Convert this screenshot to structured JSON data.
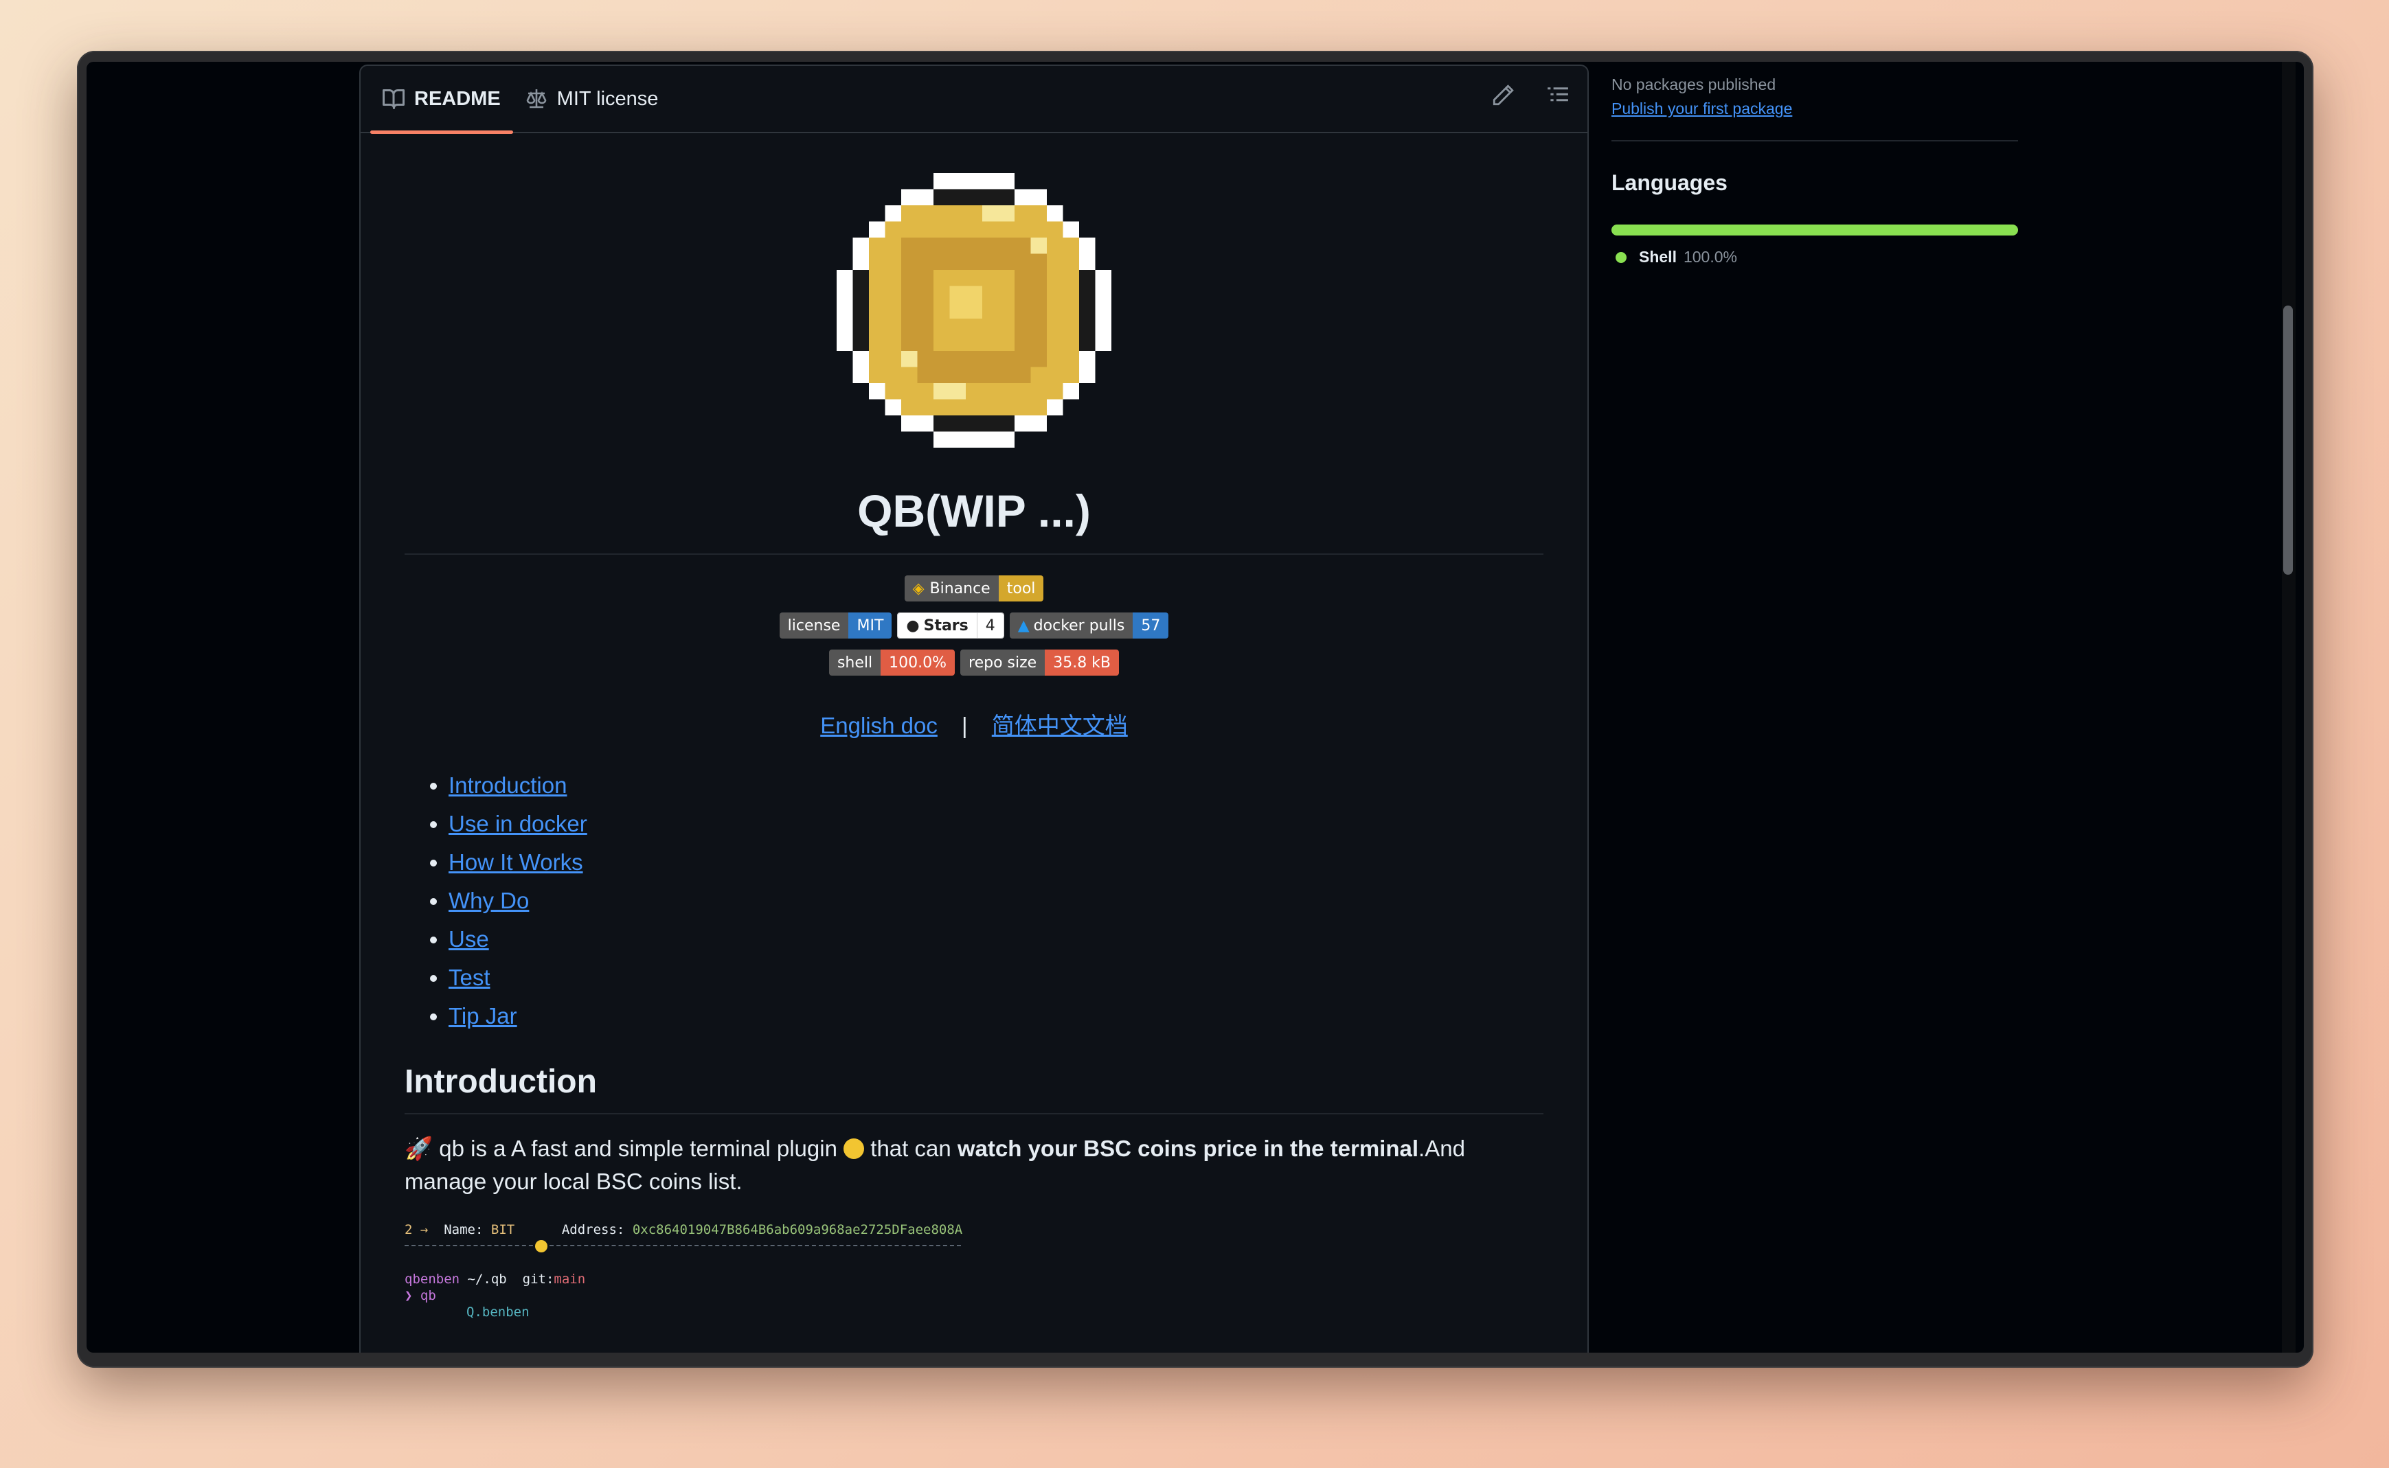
{
  "tabs": [
    {
      "label": "README",
      "icon": "book-icon",
      "active": true
    },
    {
      "label": "MIT license",
      "icon": "scale-icon",
      "active": false
    }
  ],
  "readme": {
    "title": "QB(WIP ...)",
    "badges": {
      "row1": [
        {
          "left": "Binance",
          "right": "tool",
          "color": "#d4a72c"
        }
      ],
      "row2": [
        {
          "left": "license",
          "right": "MIT",
          "color": "#2f78c4"
        },
        {
          "left": "Stars",
          "right": "4"
        },
        {
          "left": "docker pulls",
          "right": "57",
          "color": "#2f78c4"
        }
      ],
      "row3": [
        {
          "left": "shell",
          "right": "100.0%",
          "color": "#e05d44"
        },
        {
          "left": "repo size",
          "right": "35.8 kB",
          "color": "#e05d44"
        }
      ]
    },
    "lang_links": {
      "english": "English doc",
      "separator": "|",
      "chinese": "简体中文文档"
    },
    "toc": [
      "Introduction",
      "Use in docker",
      "How It Works",
      "Why Do",
      "Use",
      "Test",
      "Tip Jar"
    ],
    "intro_heading": "Introduction",
    "intro": {
      "part1": "qb is a A fast and simple terminal plugin",
      "part2": "that can",
      "bold": "watch your BSC coins price in the terminal",
      "part3": ".And manage your local BSC coins list."
    },
    "terminal": {
      "line1_num": "2 →",
      "line1_name_label": "Name:",
      "line1_name": "BIT",
      "line1_addr_label": "Address:",
      "line1_addr": "0xc864019047B864B6ab609a968ae2725DFaee808A",
      "prompt_user": "qbenben",
      "prompt_path": "~/.qb",
      "prompt_git": "git:",
      "prompt_branch": "main",
      "cmd": "❯ qb",
      "art": "Q.benben"
    }
  },
  "sidebar": {
    "packages_text": "No packages published",
    "packages_link": "Publish your first package",
    "languages_heading": "Languages",
    "languages": [
      {
        "name": "Shell",
        "percent": "100.0%",
        "color": "#89e051"
      }
    ]
  }
}
